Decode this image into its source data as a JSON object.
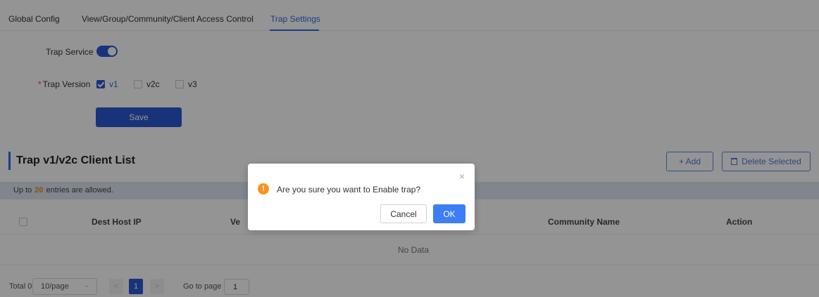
{
  "tabs": [
    {
      "label": "Global Config"
    },
    {
      "label": "View/Group/Community/Client Access Control"
    },
    {
      "label": "Trap Settings"
    }
  ],
  "form": {
    "trap_service_label": "Trap Service",
    "trap_service_enabled": true,
    "required_mark": "*",
    "trap_version_label": "Trap Version",
    "versions": [
      {
        "label": "v1",
        "checked": true
      },
      {
        "label": "v2c",
        "checked": false
      },
      {
        "label": "v3",
        "checked": false
      }
    ],
    "save_label": "Save"
  },
  "client_list": {
    "title": "Trap v1/v2c Client List",
    "add_label": "+ Add",
    "delete_label": "Delete Selected",
    "info_prefix": "Up to",
    "info_count": "20",
    "info_suffix": "entries are allowed.",
    "columns": [
      "Dest Host IP",
      "Ve",
      "Community Name",
      "Action"
    ],
    "empty_text": "No Data"
  },
  "pagination": {
    "total_label": "Total 0",
    "page_size": "10/page",
    "prev": "<",
    "current_page": "1",
    "next": ">",
    "goto_label": "Go to page",
    "goto_value": "1"
  },
  "dialog": {
    "close_glyph": "×",
    "icon_glyph": "!",
    "message": "Are you sure you want to Enable trap?",
    "cancel_label": "Cancel",
    "ok_label": "OK"
  },
  "colors": {
    "primary": "#2b58d4",
    "accent_orange": "#f08a00",
    "warning": "#f7931e"
  }
}
